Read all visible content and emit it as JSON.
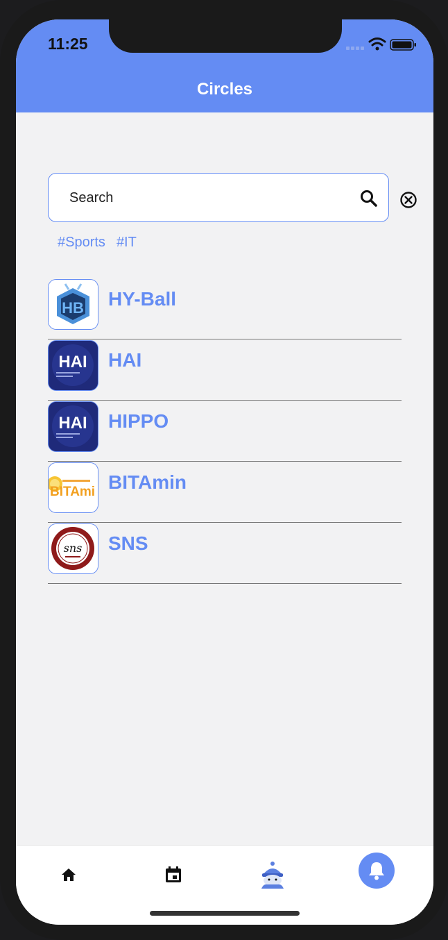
{
  "status_bar": {
    "time": "11:25"
  },
  "header": {
    "title": "Circles"
  },
  "search": {
    "placeholder": "Search",
    "value": ""
  },
  "tags": [
    "#Sports",
    "#IT"
  ],
  "circles": [
    {
      "name": "HY-Ball",
      "logo": "hyb-logo"
    },
    {
      "name": "HAI",
      "logo": "hai-logo",
      "logo_text": "HAI"
    },
    {
      "name": "HIPPO",
      "logo": "hai-logo",
      "logo_text": "HAI"
    },
    {
      "name": "BITAmin",
      "logo": "bitamin-logo",
      "logo_text": "BITAmi"
    },
    {
      "name": "SNS",
      "logo": "sns-logo",
      "logo_text": "sns"
    }
  ],
  "tab_bar": {
    "items": [
      {
        "icon": "home-icon"
      },
      {
        "icon": "calendar-icon"
      },
      {
        "icon": "mascot-icon"
      },
      {
        "icon": "bell-icon",
        "active": true
      }
    ]
  },
  "colors": {
    "accent": "#648cf3",
    "background": "#f2f2f3",
    "logo_navy": "#1f2a7a"
  }
}
